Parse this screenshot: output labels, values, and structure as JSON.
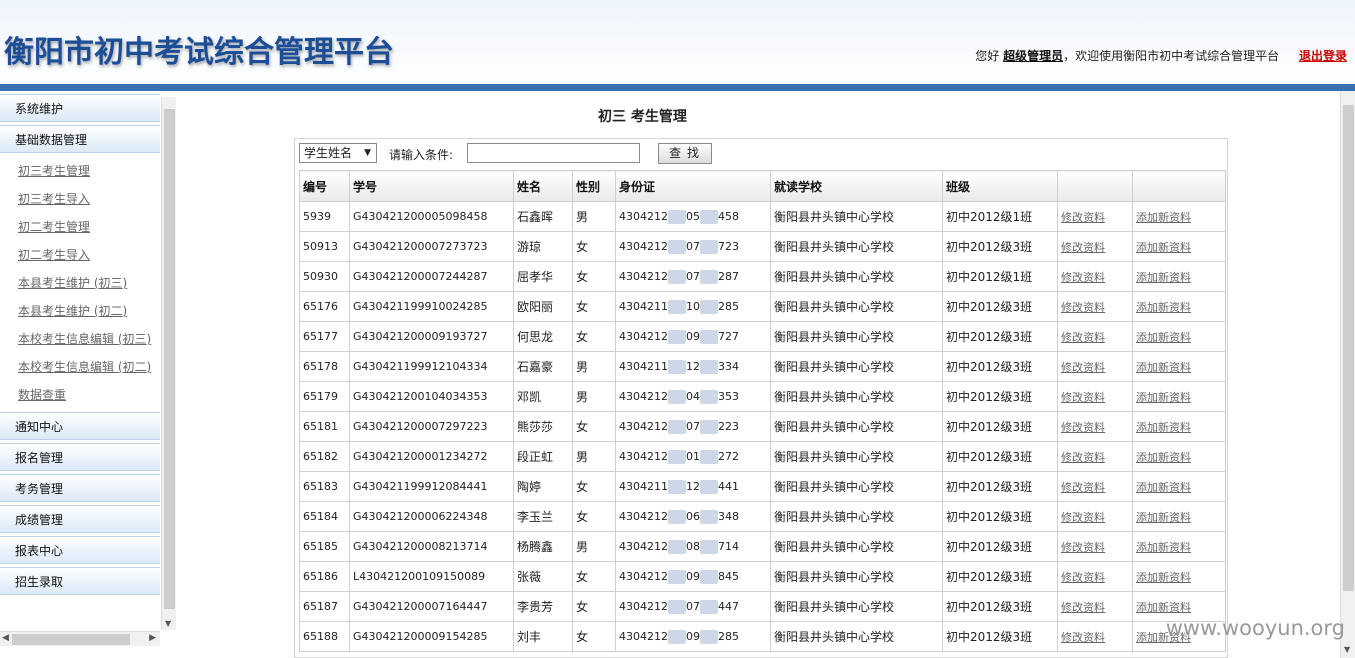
{
  "header": {
    "title": "衡阳市初中考试综合管理平台",
    "greeting_prefix": "您好",
    "user_role": "超级管理员",
    "greeting_suffix": "，欢迎使用衡阳市初中考试综合管理平台",
    "logout_label": "退出登录"
  },
  "sidebar": {
    "heads": [
      "系统维护",
      "基础数据管理",
      "通知中心",
      "报名管理",
      "考务管理",
      "成绩管理",
      "报表中心",
      "招生录取"
    ],
    "sub_items": [
      "初三考生管理",
      "初三考生导入",
      "初二考生管理",
      "初二考生导入",
      "本县考生维护 (初三)",
      "本县考生维护 (初二)",
      "本校考生信息编辑 (初三)",
      "本校考生信息编辑 (初二)",
      "数据查重"
    ]
  },
  "main": {
    "page_title": "初三  考生管理",
    "search": {
      "field_selected": "学生姓名",
      "condition_label": "请输入条件:",
      "condition_value": "",
      "find_label": "查找"
    },
    "table": {
      "columns": [
        "编号",
        "学号",
        "姓名",
        "性别",
        "身份证",
        "就读学校",
        "班级",
        "",
        ""
      ],
      "edit_label": "修改资料",
      "add_label": "添加新资料",
      "rows": [
        {
          "no": "5939",
          "sid": "G430421200005098458",
          "name": "石鑫晖",
          "gender": "男",
          "id_a": "4304212",
          "id_b": "05",
          "id_c": "458",
          "school": "衡阳县井头镇中心学校",
          "klass": "初中2012级1班"
        },
        {
          "no": "50913",
          "sid": "G430421200007273723",
          "name": "游琼",
          "gender": "女",
          "id_a": "4304212",
          "id_b": "07",
          "id_c": "723",
          "school": "衡阳县井头镇中心学校",
          "klass": "初中2012级3班"
        },
        {
          "no": "50930",
          "sid": "G430421200007244287",
          "name": "屈孝华",
          "gender": "女",
          "id_a": "4304212",
          "id_b": "07",
          "id_c": "287",
          "school": "衡阳县井头镇中心学校",
          "klass": "初中2012级1班"
        },
        {
          "no": "65176",
          "sid": "G430421199910024285",
          "name": "欧阳丽",
          "gender": "女",
          "id_a": "4304211",
          "id_b": "10",
          "id_c": "285",
          "school": "衡阳县井头镇中心学校",
          "klass": "初中2012级3班"
        },
        {
          "no": "65177",
          "sid": "G430421200009193727",
          "name": "何思龙",
          "gender": "女",
          "id_a": "4304212",
          "id_b": "09",
          "id_c": "727",
          "school": "衡阳县井头镇中心学校",
          "klass": "初中2012级3班"
        },
        {
          "no": "65178",
          "sid": "G430421199912104334",
          "name": "石嘉豪",
          "gender": "男",
          "id_a": "4304211",
          "id_b": "12",
          "id_c": "334",
          "school": "衡阳县井头镇中心学校",
          "klass": "初中2012级3班"
        },
        {
          "no": "65179",
          "sid": "G430421200104034353",
          "name": "邓凯",
          "gender": "男",
          "id_a": "4304212",
          "id_b": "04",
          "id_c": "353",
          "school": "衡阳县井头镇中心学校",
          "klass": "初中2012级3班"
        },
        {
          "no": "65181",
          "sid": "G430421200007297223",
          "name": "熊莎莎",
          "gender": "女",
          "id_a": "4304212",
          "id_b": "07",
          "id_c": "223",
          "school": "衡阳县井头镇中心学校",
          "klass": "初中2012级3班"
        },
        {
          "no": "65182",
          "sid": "G430421200001234272",
          "name": "段正虹",
          "gender": "男",
          "id_a": "4304212",
          "id_b": "01",
          "id_c": "272",
          "school": "衡阳县井头镇中心学校",
          "klass": "初中2012级3班"
        },
        {
          "no": "65183",
          "sid": "G430421199912084441",
          "name": "陶婷",
          "gender": "女",
          "id_a": "4304211",
          "id_b": "12",
          "id_c": "441",
          "school": "衡阳县井头镇中心学校",
          "klass": "初中2012级3班"
        },
        {
          "no": "65184",
          "sid": "G430421200006224348",
          "name": "李玉兰",
          "gender": "女",
          "id_a": "4304212",
          "id_b": "06",
          "id_c": "348",
          "school": "衡阳县井头镇中心学校",
          "klass": "初中2012级3班"
        },
        {
          "no": "65185",
          "sid": "G430421200008213714",
          "name": "杨腾鑫",
          "gender": "男",
          "id_a": "4304212",
          "id_b": "08",
          "id_c": "714",
          "school": "衡阳县井头镇中心学校",
          "klass": "初中2012级3班"
        },
        {
          "no": "65186",
          "sid": "L430421200109150089",
          "name": "张薇",
          "gender": "女",
          "id_a": "4304212",
          "id_b": "09",
          "id_c": "845",
          "school": "衡阳县井头镇中心学校",
          "klass": "初中2012级3班"
        },
        {
          "no": "65187",
          "sid": "G430421200007164447",
          "name": "李贵芳",
          "gender": "女",
          "id_a": "4304212",
          "id_b": "07",
          "id_c": "447",
          "school": "衡阳县井头镇中心学校",
          "klass": "初中2012级3班"
        },
        {
          "no": "65188",
          "sid": "G430421200009154285",
          "name": "刘丰",
          "gender": "女",
          "id_a": "4304212",
          "id_b": "09",
          "id_c": "285",
          "school": "衡阳县井头镇中心学校",
          "klass": "初中2012级3班"
        }
      ]
    }
  },
  "watermark": "www.wooyun.org",
  "colors": {
    "title_blue": "#1c4e98",
    "header_bar": "#3a6fb0",
    "logout_red": "#cc0000"
  }
}
